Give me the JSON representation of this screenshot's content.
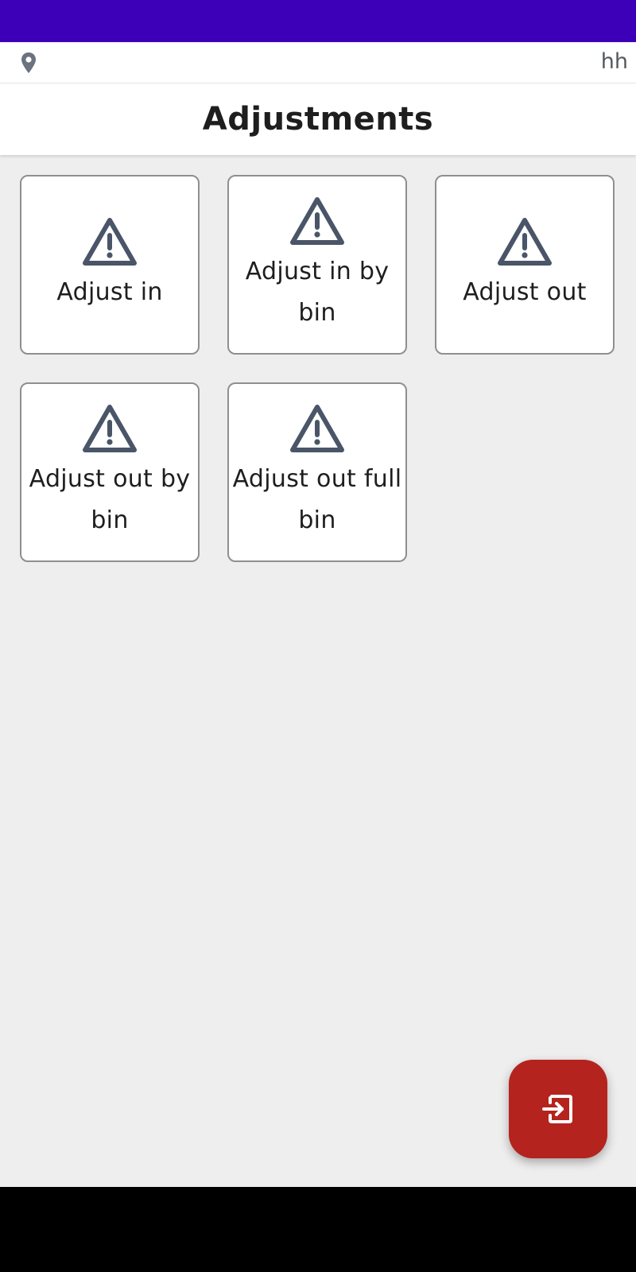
{
  "colors": {
    "status_bar": "#3d00b8",
    "accent_fab": "#b5231e",
    "icon": "#4a5568",
    "text": "#1e1e1e",
    "background": "#eeeeee"
  },
  "location_bar": {
    "icon": "location-pin-icon",
    "user": "hh"
  },
  "header": {
    "title": "Adjustments"
  },
  "tiles": [
    {
      "label": "Adjust in",
      "icon": "warning-icon"
    },
    {
      "label": "Adjust in by bin",
      "icon": "warning-icon"
    },
    {
      "label": "Adjust out",
      "icon": "warning-icon"
    },
    {
      "label": "Adjust out by bin",
      "icon": "warning-icon"
    },
    {
      "label": "Adjust out full bin",
      "icon": "warning-icon"
    }
  ],
  "fab": {
    "icon": "exit-icon"
  }
}
